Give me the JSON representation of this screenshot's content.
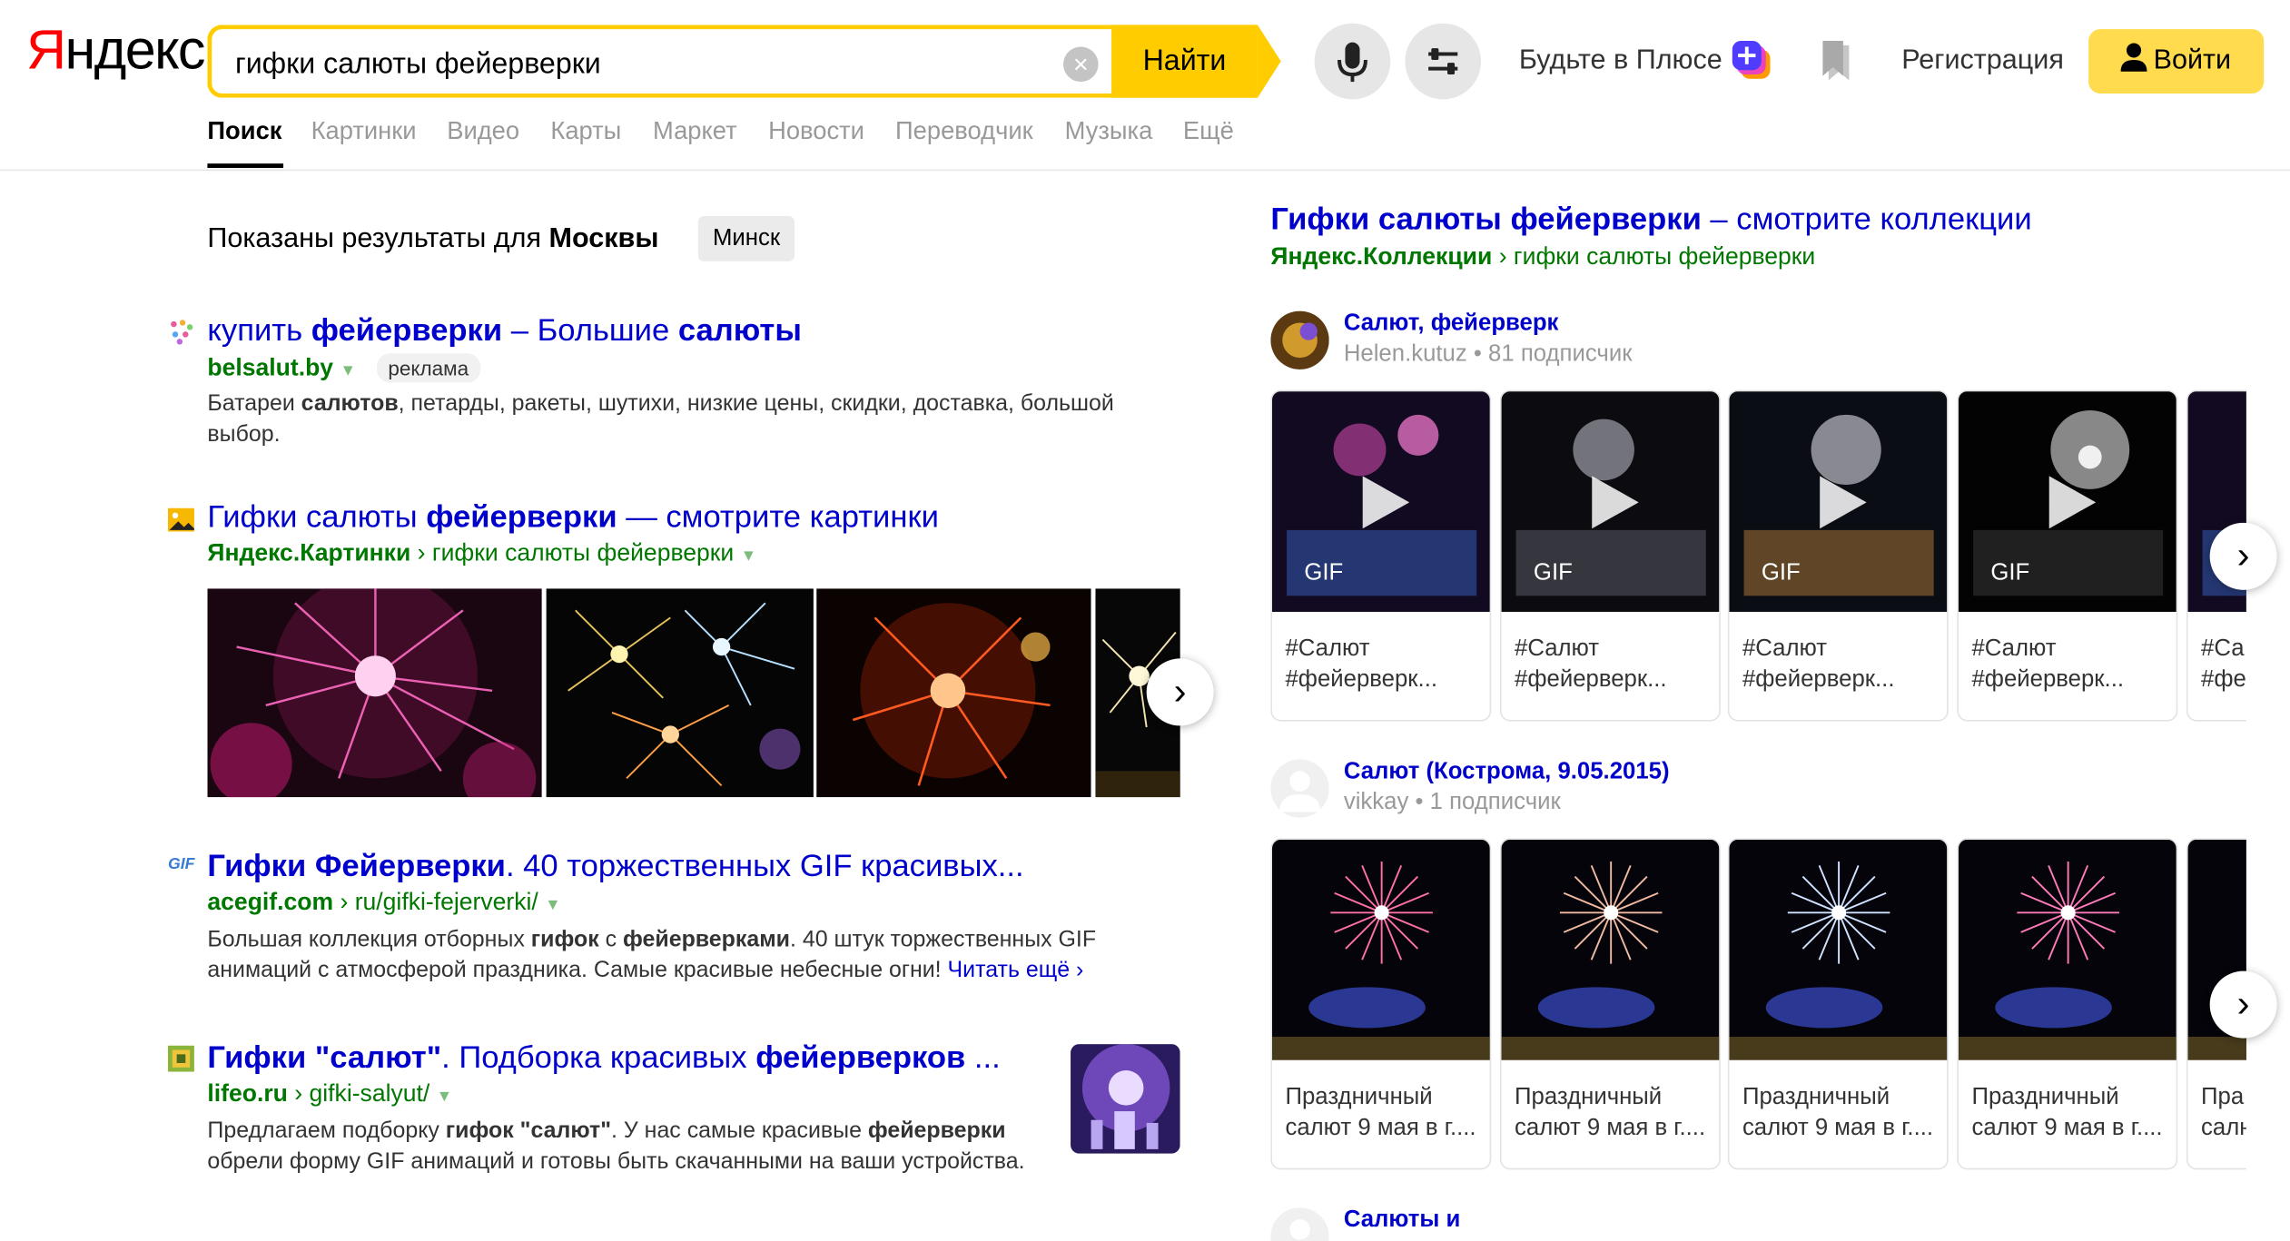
{
  "header": {
    "logo": "Яндекс",
    "search_value": "гифки салюты фейерверки",
    "find_label": "Найти",
    "plus_label": "Будьте в Плюсе",
    "register_label": "Регистрация",
    "login_label": "Войти"
  },
  "tabs": [
    "Поиск",
    "Картинки",
    "Видео",
    "Карты",
    "Маркет",
    "Новости",
    "Переводчик",
    "Музыка",
    "Ещё"
  ],
  "region": {
    "prefix": "Показаны результаты для ",
    "city": "Москвы",
    "alt_city": "Минск"
  },
  "results": [
    {
      "title_parts": [
        "купить ",
        "фейерверки",
        " – Большие ",
        "салюты"
      ],
      "url_domain": "belsalut.by",
      "ad_label": "реклама",
      "desc_parts": [
        "Батареи ",
        "салютов",
        ", петарды, ракеты, шутихи, низкие цены, скидки, доставка, большой выбор."
      ]
    },
    {
      "title_parts": [
        "Гифки салюты ",
        "фейерверки",
        " — смотрите картинки"
      ],
      "url_domain": "Яндекс.Картинки",
      "url_path": "гифки салюты фейерверки"
    },
    {
      "title_parts": [
        "Гифки Фейерверки",
        ". 40 торжественных GIF красивых..."
      ],
      "url_domain": "acegif.com",
      "url_path": "ru/gifki-fejerverki/",
      "desc_parts": [
        "Большая коллекция отборных ",
        "гифок",
        " с ",
        "фейерверками",
        ". 40 штук торжественных GIF анимаций с атмосферой праздника. Самые красивые небесные огни! "
      ],
      "more_label": "Читать ещё"
    },
    {
      "title_parts": [
        "Гифки ",
        "\"салют\"",
        ". Подборка красивых ",
        "фейерверков",
        " ..."
      ],
      "url_domain": "lifeo.ru",
      "url_path": "gifki-salyut/",
      "desc_parts": [
        "Предлагаем подборку ",
        "гифок",
        " ",
        "\"салют\"",
        ". У нас самые красивые ",
        "фейерверки",
        " обрели форму GIF анимаций и готовы быть скачанными на ваши устройства."
      ]
    }
  ],
  "collections": {
    "title_bold": "Гифки салюты фейерверки",
    "title_rest": " – смотрите коллекции",
    "url_domain": "Яндекс.Коллекции",
    "url_path": "гифки салюты фейерверки",
    "groups": [
      {
        "name": "Салют, фейерверк",
        "author": "Helen.kutuz",
        "subscribers": "81 подписчик",
        "gif_label": "GIF",
        "card_line1": "#Салют",
        "card_line2": "#фейерверк...",
        "partial_line1": "#Са",
        "partial_line2": "#фе"
      },
      {
        "name": "Салют (Кострома, 9.05.2015)",
        "author": "vikkay",
        "subscribers": "1 подписчик",
        "card_line1": "Праздничный",
        "card_line2": "салют 9 мая в г....",
        "partial_line1": "Пра",
        "partial_line2": "салн"
      },
      {
        "name": "Салюты и"
      }
    ]
  },
  "colors": {
    "link": "#0000cc",
    "url_green": "#007700",
    "yandex_yellow": "#ffcc00",
    "logo_red": "#ff0000"
  }
}
